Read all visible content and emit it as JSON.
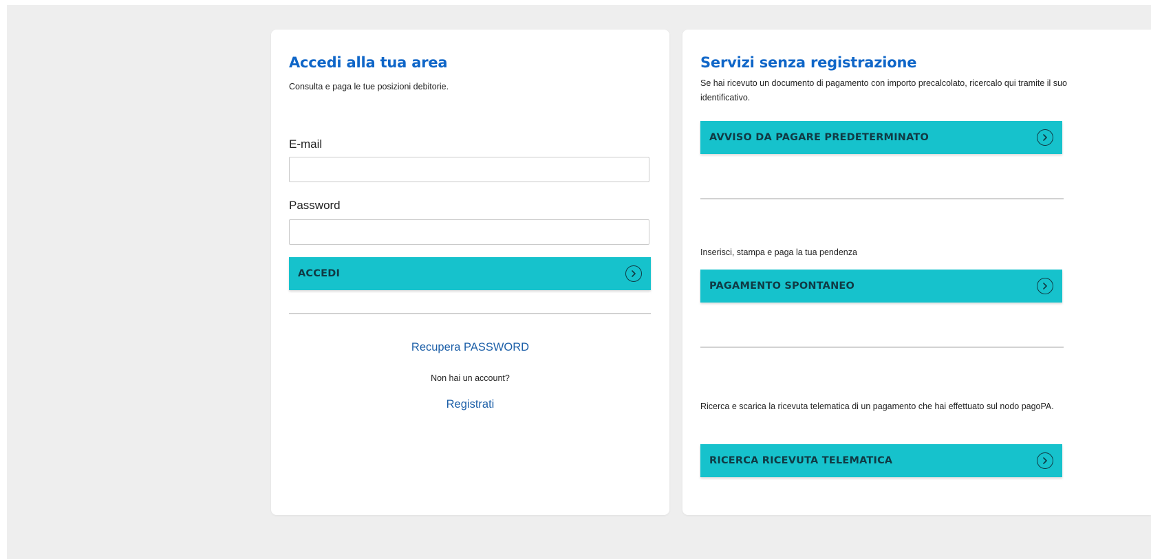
{
  "colors": {
    "page_background": "#eeeeee",
    "card_background": "#ffffff",
    "title_blue": "#0f66c8",
    "button_teal": "#16c2cc",
    "button_text": "#103a44",
    "link_blue": "#1c5fa8"
  },
  "login": {
    "title": "Accedi alla tua area",
    "subtitle": "Consulta e paga le tue posizioni debitorie.",
    "email_label": "E-mail",
    "email_value": "",
    "password_label": "Password",
    "password_value": "",
    "submit_label": "ACCEDI",
    "submit_icon": "chevron-right-circle-icon",
    "recover_link": "Recupera PASSWORD",
    "no_account_text": "Non hai un account?",
    "register_link": "Registrati"
  },
  "services": {
    "title": "Servizi senza registrazione",
    "intro": "Se hai ricevuto un documento di pagamento con importo precalcolato, ricercalo qui tramite il suo identificativo.",
    "avviso_button": "AVVISO DA PAGARE PREDETERMINATO",
    "spontaneo_text": "Inserisci, stampa e paga la tua pendenza",
    "spontaneo_button": "PAGAMENTO SPONTANEO",
    "ricevuta_text": "Ricerca e scarica la ricevuta telematica di un pagamento che hai effettuato sul nodo pagoPA.",
    "ricevuta_button": "RICERCA RICEVUTA TELEMATICA",
    "button_icon": "chevron-right-circle-icon"
  }
}
